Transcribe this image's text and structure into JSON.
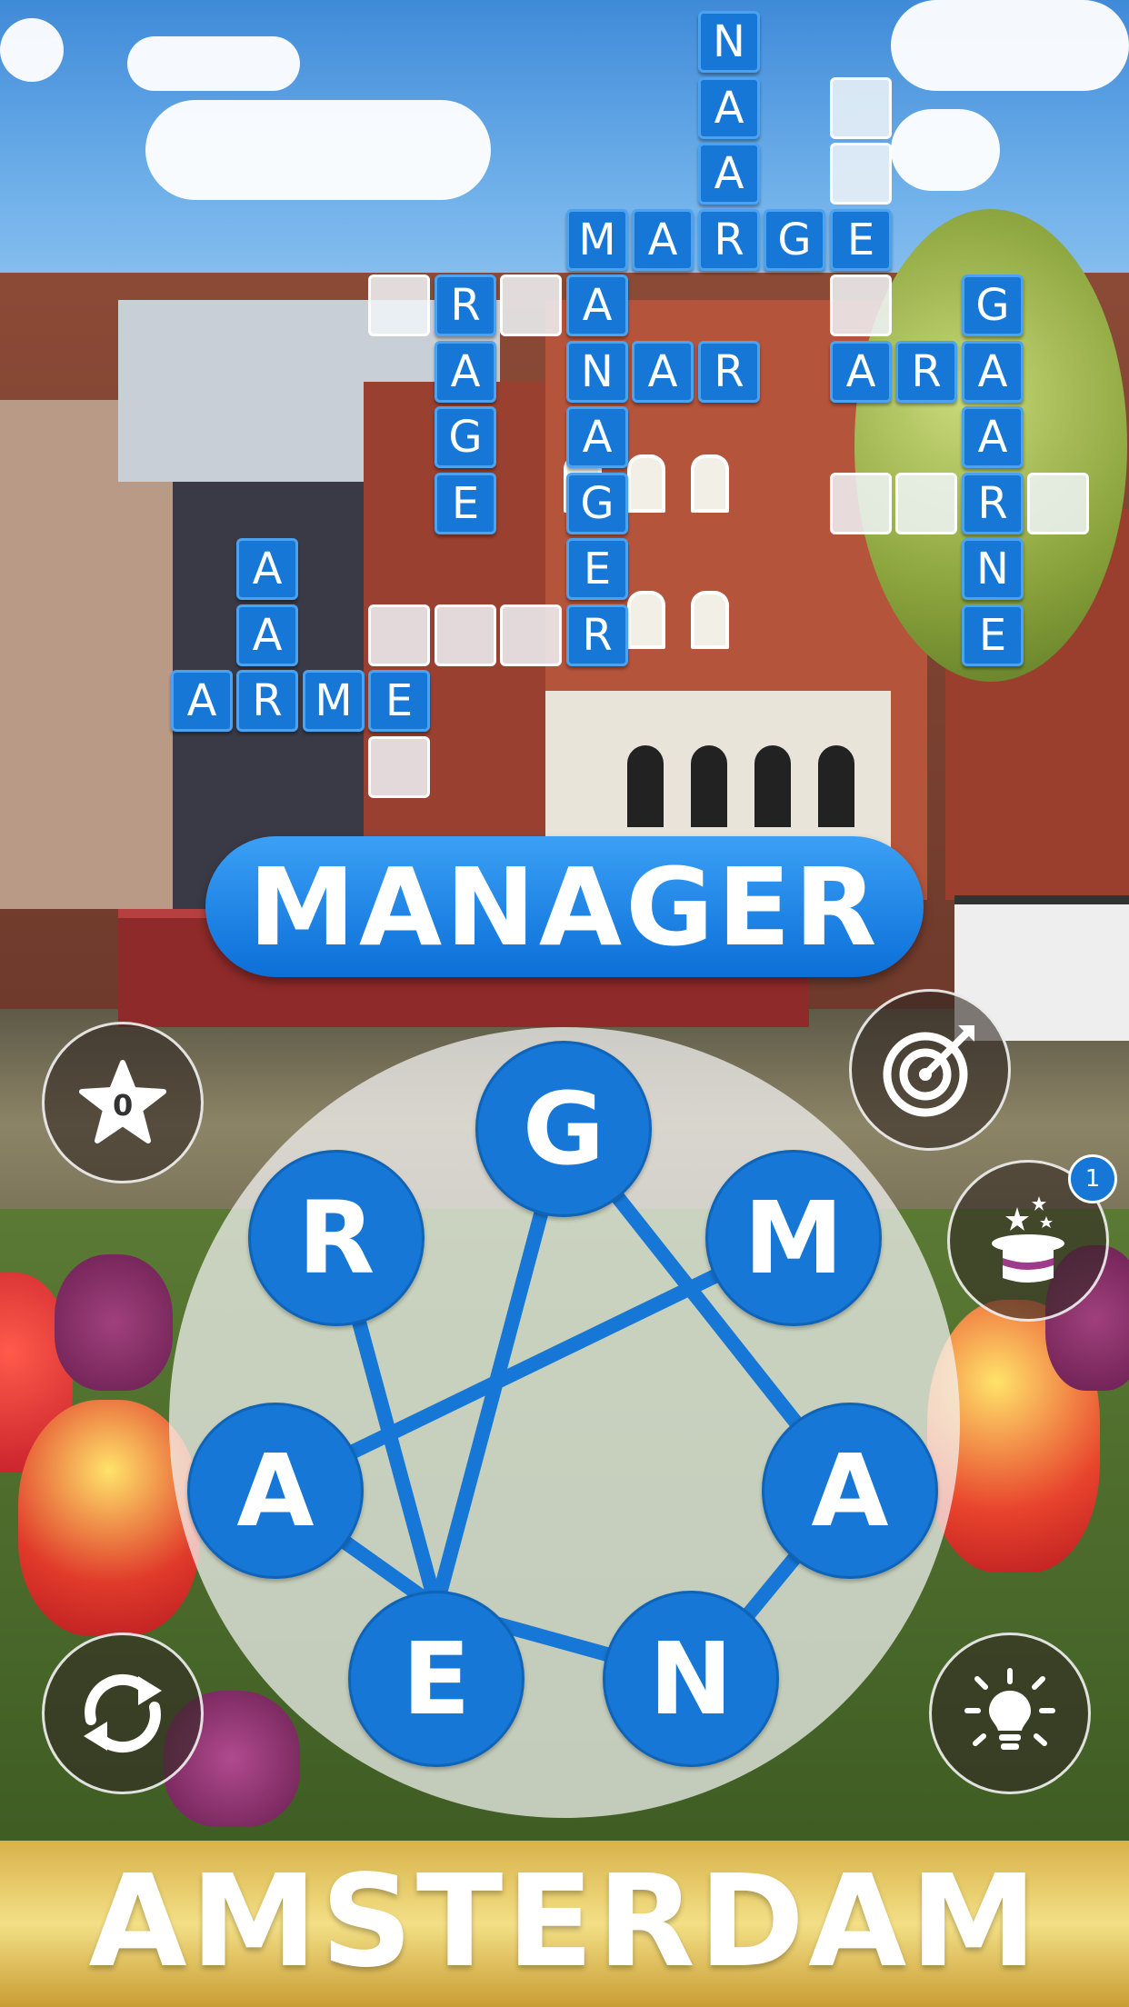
{
  "game": {
    "current_word": "MANAGER",
    "level_name": "AMSTERDAM",
    "wheel_letters": [
      "G",
      "M",
      "A",
      "N",
      "E",
      "A",
      "R"
    ],
    "stars_count": "0",
    "magic_hat_count": "1"
  },
  "crossword": {
    "tiles": [
      {
        "letter": "N",
        "col": 9,
        "row": 0
      },
      {
        "letter": "A",
        "col": 9,
        "row": 1
      },
      {
        "letter": "A",
        "col": 9,
        "row": 2
      },
      {
        "letter": "",
        "col": 11,
        "row": 1
      },
      {
        "letter": "",
        "col": 11,
        "row": 2
      },
      {
        "letter": "M",
        "col": 7,
        "row": 3
      },
      {
        "letter": "A",
        "col": 8,
        "row": 3
      },
      {
        "letter": "R",
        "col": 9,
        "row": 3
      },
      {
        "letter": "G",
        "col": 10,
        "row": 3
      },
      {
        "letter": "E",
        "col": 11,
        "row": 3
      },
      {
        "letter": "",
        "col": 4,
        "row": 4
      },
      {
        "letter": "R",
        "col": 5,
        "row": 4
      },
      {
        "letter": "",
        "col": 6,
        "row": 4
      },
      {
        "letter": "A",
        "col": 7,
        "row": 4
      },
      {
        "letter": "",
        "col": 11,
        "row": 4
      },
      {
        "letter": "G",
        "col": 13,
        "row": 4
      },
      {
        "letter": "A",
        "col": 5,
        "row": 5
      },
      {
        "letter": "N",
        "col": 7,
        "row": 5
      },
      {
        "letter": "A",
        "col": 8,
        "row": 5
      },
      {
        "letter": "R",
        "col": 9,
        "row": 5
      },
      {
        "letter": "A",
        "col": 11,
        "row": 5
      },
      {
        "letter": "R",
        "col": 12,
        "row": 5
      },
      {
        "letter": "A",
        "col": 13,
        "row": 5
      },
      {
        "letter": "G",
        "col": 5,
        "row": 6
      },
      {
        "letter": "A",
        "col": 7,
        "row": 6
      },
      {
        "letter": "A",
        "col": 13,
        "row": 6
      },
      {
        "letter": "E",
        "col": 5,
        "row": 7
      },
      {
        "letter": "G",
        "col": 7,
        "row": 7
      },
      {
        "letter": "",
        "col": 11,
        "row": 7
      },
      {
        "letter": "",
        "col": 12,
        "row": 7
      },
      {
        "letter": "R",
        "col": 13,
        "row": 7
      },
      {
        "letter": "",
        "col": 14,
        "row": 7
      },
      {
        "letter": "A",
        "col": 2,
        "row": 8
      },
      {
        "letter": "E",
        "col": 7,
        "row": 8
      },
      {
        "letter": "N",
        "col": 13,
        "row": 8
      },
      {
        "letter": "A",
        "col": 2,
        "row": 9
      },
      {
        "letter": "",
        "col": 4,
        "row": 9
      },
      {
        "letter": "",
        "col": 5,
        "row": 9
      },
      {
        "letter": "",
        "col": 6,
        "row": 9
      },
      {
        "letter": "R",
        "col": 7,
        "row": 9
      },
      {
        "letter": "E",
        "col": 13,
        "row": 9
      },
      {
        "letter": "A",
        "col": 1,
        "row": 10
      },
      {
        "letter": "R",
        "col": 2,
        "row": 10
      },
      {
        "letter": "M",
        "col": 3,
        "row": 10
      },
      {
        "letter": "E",
        "col": 4,
        "row": 10
      },
      {
        "letter": "",
        "col": 4,
        "row": 11
      }
    ]
  },
  "icons": {
    "star": "star-icon",
    "target": "target-icon",
    "magic_hat": "magic-hat-icon",
    "shuffle": "shuffle-icon",
    "hint": "lightbulb-icon"
  },
  "colors": {
    "tile_blue": "#1677d6",
    "banner_gold": "#e6c660",
    "wheel_line": "#1677d6"
  }
}
